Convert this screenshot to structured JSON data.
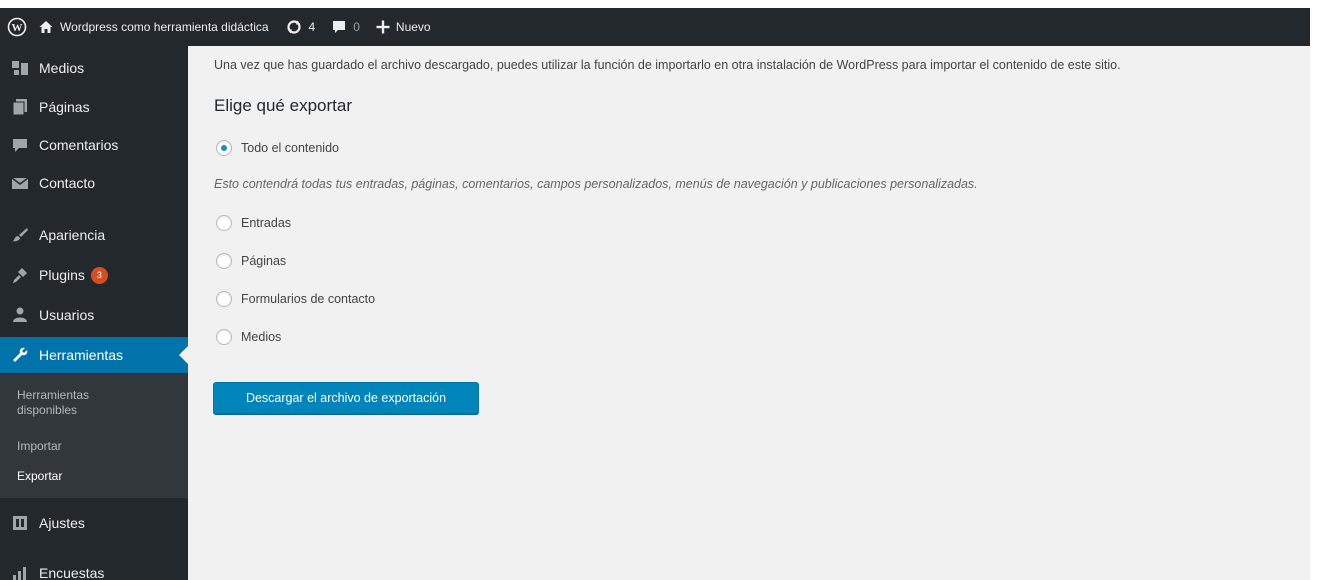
{
  "adminbar": {
    "site_name": "Wordpress como herramienta didáctica",
    "updates_count": "4",
    "comments_count": "0",
    "new_label": "Nuevo"
  },
  "sidebar": {
    "items": [
      {
        "label": "Medios",
        "icon": "media-icon"
      },
      {
        "label": "Páginas",
        "icon": "pages-icon"
      },
      {
        "label": "Comentarios",
        "icon": "comments-icon"
      },
      {
        "label": "Contacto",
        "icon": "mail-icon"
      },
      {
        "label": "Apariencia",
        "icon": "paintbrush-icon"
      },
      {
        "label": "Plugins",
        "icon": "plugin-icon",
        "badge": "3"
      },
      {
        "label": "Usuarios",
        "icon": "users-icon"
      },
      {
        "label": "Herramientas",
        "icon": "wrench-icon",
        "active": true
      },
      {
        "label": "Ajustes",
        "icon": "settings-icon"
      },
      {
        "label": "Encuestas",
        "icon": "chart-bars-icon"
      }
    ],
    "submenu": [
      {
        "label": "Herramientas\ndisponibles"
      },
      {
        "label": "Importar"
      },
      {
        "label": "Exportar",
        "current": true
      }
    ]
  },
  "main": {
    "intro": "Una vez que has guardado el archivo descargado, puedes utilizar la función de importarlo en otra instalación de WordPress para importar el contenido de este sitio.",
    "heading": "Elige qué exportar",
    "options": [
      {
        "label": "Todo el contenido",
        "checked": true
      },
      {
        "label": "Entradas",
        "checked": false
      },
      {
        "label": "Páginas",
        "checked": false
      },
      {
        "label": "Formularios de contacto",
        "checked": false
      },
      {
        "label": "Medios",
        "checked": false
      }
    ],
    "all_content_description": "Esto contendrá todas tus entradas, páginas, comentarios, campos personalizados, menús de navegación y publicaciones personalizadas.",
    "download_button": "Descargar el archivo de exportación"
  },
  "colors": {
    "adminbar_bg": "#23282d",
    "sidebar_bg": "#23282d",
    "accent": "#0073aa",
    "button": "#0085ba",
    "badge": "#d54e21"
  }
}
